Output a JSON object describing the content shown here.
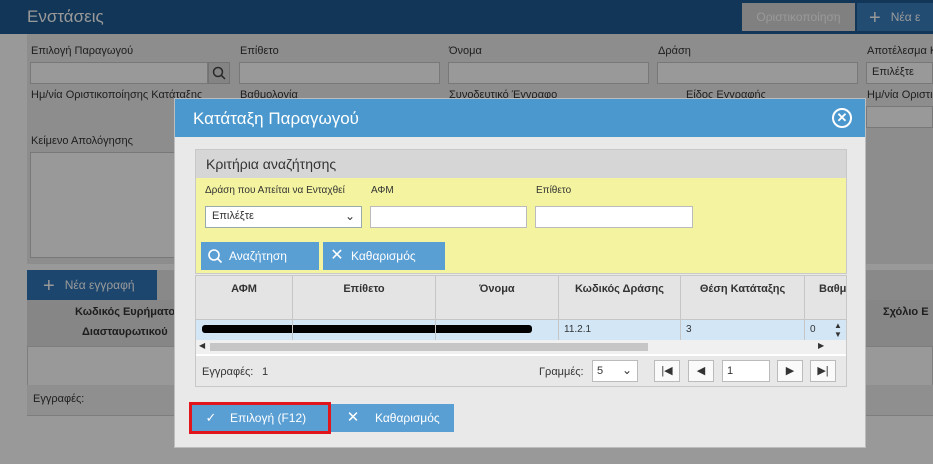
{
  "page": {
    "title": "Ενστάσεις",
    "btn_finalize": "Οριστικοποίηση",
    "btn_new": "Νέα ε",
    "form_labels": {
      "producer": "Επιλογή Παραγωγού",
      "surname": "Επίθετο",
      "name": "Όνομα",
      "action": "Δράση",
      "result": "Αποτέλεσμα Κ",
      "date": "Ημ/νία Οριστικοποίησης Κατάταξης",
      "score": "Βαθμολογία",
      "doc": "Συνοδευτικό Έγγραφο",
      "doc_type": "Είδος Εγγραφής",
      "final_date": "Ημ/νία Οριστικ",
      "text": "Κείμενο Απολόγησης"
    },
    "result_value": "Επιλέξτε",
    "new_record": "Νέα εγγραφή",
    "grid_col1_line1": "Κωδικός Ευρήματο",
    "grid_col1_line2": "Διασταυρωτικού",
    "grid_col_comment": "Σχόλιο Ε",
    "records": "Εγγραφές:"
  },
  "modal": {
    "title": "Κατάταξη Παραγωγού",
    "criteria_title": "Κριτήρια αναζήτησης",
    "criteria_labels": {
      "action": "Δράση που Απείται να Ενταχθεί",
      "afm": "ΑΦΜ",
      "surname": "Επίθετο"
    },
    "action_select_value": "Επιλέξτε",
    "search_button": "Αναζήτηση",
    "clear_button": "Καθαρισμός",
    "columns": [
      "ΑΦΜ",
      "Επίθετο",
      "Όνομα",
      "Κωδικός Δράσης",
      "Θέση Κατάταξης",
      "Βαθμ"
    ],
    "rows": [
      {
        "code": "11.2.1",
        "position": "3",
        "score": "0"
      }
    ],
    "records_label": "Εγγραφές:",
    "records_count": "1",
    "rows_label": "Γραμμές:",
    "rows_per_page": "5",
    "page_value": "1",
    "select_button": "Επιλογή (F12)",
    "clear_button_bottom": "Καθαρισμός"
  },
  "colors": {
    "header": "#1d5a91",
    "modal_header": "#4a98cd",
    "button": "#5a9fd4",
    "criteria_bg": "#f3f3a0",
    "highlight": "#e0161c"
  }
}
